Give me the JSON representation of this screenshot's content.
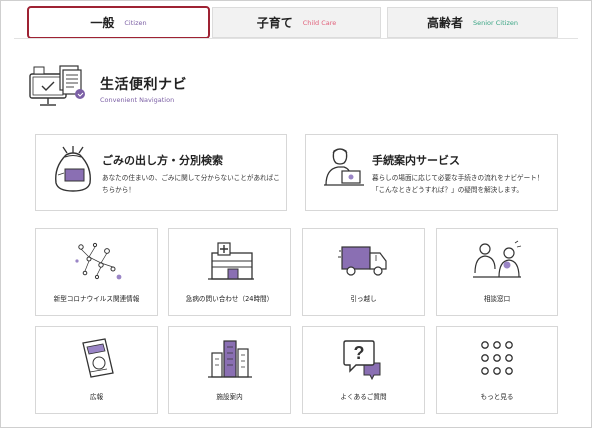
{
  "tabs": [
    {
      "label": "一般",
      "en": "Citizen",
      "en_color": "#7b5fa5",
      "active": true
    },
    {
      "label": "子育て",
      "en": "Child Care",
      "en_color": "#e0607a",
      "active": false
    },
    {
      "label": "高齢者",
      "en": "Senior Citizen",
      "en_color": "#3aa584",
      "active": false
    }
  ],
  "header": {
    "title": "生活便利ナビ",
    "subtitle": "Convenient Navigation",
    "icon": "computer-documents-icon"
  },
  "wide_cards": [
    {
      "title": "ごみの出し方・分別検索",
      "description": "あなたの住まいの、ごみに関して分からないことがあればこちらから！",
      "icon": "garbage-bag-icon"
    },
    {
      "title": "手続案内サービス",
      "description": "暮らしの場面に応じて必要な手続きの流れをナビゲート！「こんなときどうすれば？」の疑問を解決します。",
      "icon": "person-laptop-icon"
    }
  ],
  "tiles": [
    {
      "label": "新型コロナウイルス関連情報",
      "icon": "virus-icon"
    },
    {
      "label": "急病の問い合わせ（24時間）",
      "icon": "hospital-icon"
    },
    {
      "label": "引っ越し",
      "icon": "moving-truck-icon"
    },
    {
      "label": "相談窓口",
      "icon": "consultation-icon"
    },
    {
      "label": "広報",
      "icon": "magazine-icon"
    },
    {
      "label": "施設案内",
      "icon": "building-icon"
    },
    {
      "label": "よくあるご質問",
      "icon": "faq-bubble-icon"
    },
    {
      "label": "もっと見る",
      "icon": "grid-dots-icon"
    }
  ],
  "colors": {
    "accent": "#7b5fa5",
    "active_border": "#9e2233",
    "line": "#333333"
  }
}
